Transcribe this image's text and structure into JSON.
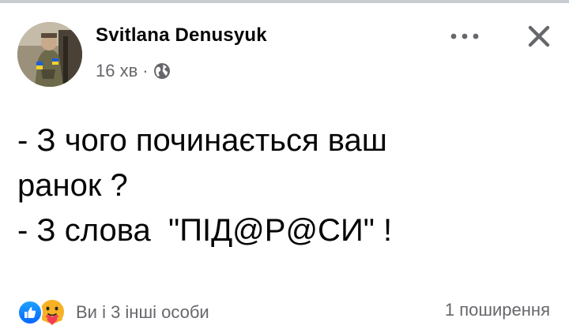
{
  "post": {
    "author": "Svitlana Denusyuk",
    "time": "16 хв",
    "separator": "·",
    "visibility_icon": "globe-icon",
    "text_lines": [
      "- З чого починається ваш",
      "ранок ?",
      "- З слова  \"ПІД@Р@СИ\" !"
    ]
  },
  "header": {
    "more_icon": "more-horizontal-icon",
    "close_icon": "close-icon"
  },
  "footer": {
    "reaction_icons": [
      "like-icon",
      "care-icon"
    ],
    "reactions_text": "Ви і 3 інші особи",
    "shares_text": "1 поширення"
  },
  "colors": {
    "text_primary": "#050505",
    "text_secondary": "#65676b",
    "like_blue": "#0866ff",
    "care_yellow": "#f7b125",
    "care_heart": "#f33e58"
  }
}
